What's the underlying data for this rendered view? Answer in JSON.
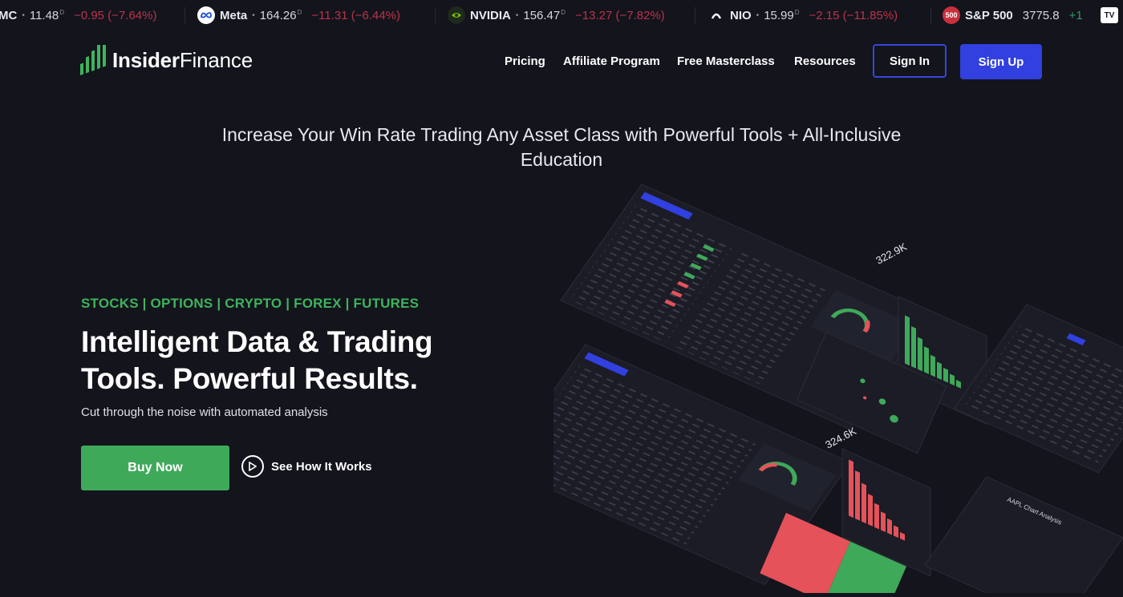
{
  "ticker": [
    {
      "symbol": "MC",
      "price": "11.48",
      "flag": "D",
      "change": "−0.95 (−7.64%)",
      "logo": ""
    },
    {
      "symbol": "Meta",
      "price": "164.26",
      "flag": "D",
      "change": "−11.31 (−6.44%)",
      "logo": "meta"
    },
    {
      "symbol": "NVIDIA",
      "price": "156.47",
      "flag": "D",
      "change": "−13.27 (−7.82%)",
      "logo": "nvidia"
    },
    {
      "symbol": "NIO",
      "price": "15.99",
      "flag": "D",
      "change": "−2.15 (−11.85%)",
      "logo": "nio"
    },
    {
      "symbol": "S&P 500",
      "price": "3775.8",
      "flag": "",
      "change": "+1",
      "logo": "500"
    }
  ],
  "brand": {
    "name_bold": "Insider",
    "name_light": "Finance"
  },
  "nav": {
    "pricing": "Pricing",
    "affiliate": "Affiliate Program",
    "masterclass": "Free Masterclass",
    "resources": "Resources",
    "sign_in": "Sign In",
    "sign_up": "Sign Up"
  },
  "headline": "Increase Your Win Rate Trading Any Asset Class with Powerful Tools + All-Inclusive Education",
  "hero": {
    "asset_classes": "STOCKS | OPTIONS | CRYPTO | FOREX | FUTURES",
    "title": "Intelligent Data & Trading Tools. Powerful Results.",
    "subtitle": "Cut through the noise with automated analysis",
    "buy_label": "Buy Now",
    "how_label": "See How It Works"
  },
  "dashboard": {
    "metric_1": "322.9K",
    "metric_2": "324.6K",
    "panel_label": "AAPL Chart Analysis"
  },
  "colors": {
    "accent_blue": "#3140de",
    "green": "#3fa95a",
    "red": "#e5525a",
    "ticker_red": "#b9344a"
  }
}
